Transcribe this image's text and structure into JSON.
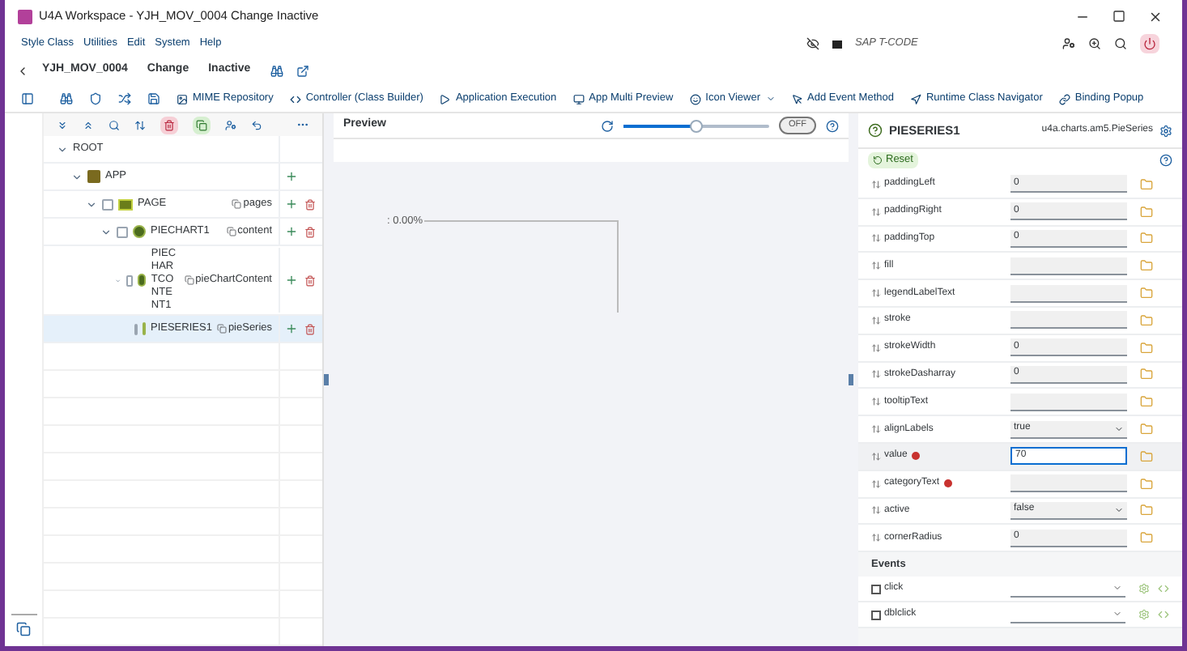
{
  "window": {
    "title": "U4A Workspace - YJH_MOV_0004 Change Inactive"
  },
  "menu": [
    "Style Class",
    "Utilities",
    "Edit",
    "System",
    "Help"
  ],
  "tcode": {
    "placeholder": "SAP T-CODE"
  },
  "breadcrumb": {
    "program": "YJH_MOV_0004",
    "mode": "Change",
    "status": "Inactive"
  },
  "toolbar": [
    {
      "label": "MIME Repository"
    },
    {
      "label": "Controller (Class Builder)"
    },
    {
      "label": "Application Execution"
    },
    {
      "label": "App Multi Preview"
    },
    {
      "label": "Icon Viewer",
      "dropdown": true
    },
    {
      "label": "Add Event Method"
    },
    {
      "label": "Runtime Class Navigator"
    },
    {
      "label": "Binding Popup"
    }
  ],
  "tree": [
    {
      "label": "ROOT",
      "kind": "root",
      "expanded": true,
      "selected": false,
      "children": [
        {
          "label": "APP",
          "kind": "app",
          "expanded": true,
          "selected": false,
          "children": [
            {
              "label": "PAGE",
              "kind": "page",
              "aggregation": "pages",
              "expanded": true,
              "selected": false,
              "children": [
                {
                  "label": "PIECHART1",
                  "kind": "control",
                  "aggregation": "content",
                  "expanded": true,
                  "selected": false,
                  "children": [
                    {
                      "label": "PIECHARTCONTENT1",
                      "kind": "control",
                      "aggregation": "pieChartContent",
                      "expanded": true,
                      "selected": false,
                      "children": [
                        {
                          "label": "PIESERIES1",
                          "kind": "control",
                          "aggregation": "pieSeries",
                          "selected": true
                        }
                      ]
                    }
                  ]
                }
              ]
            }
          ]
        }
      ]
    }
  ],
  "preview": {
    "title": "Preview",
    "zoom": {
      "level": 0.5
    },
    "toggle": {
      "label": "OFF",
      "on": false
    },
    "chart_label": ": 0.00%"
  },
  "properties": {
    "title": "PIESERIES1",
    "class_name": "u4a.charts.am5.PieSeries",
    "reset": "Reset",
    "rows": [
      {
        "name": "paddingLeft",
        "kind": "input",
        "value": "0",
        "required": false,
        "focused": false
      },
      {
        "name": "paddingRight",
        "kind": "input",
        "value": "0",
        "required": false,
        "focused": false
      },
      {
        "name": "paddingTop",
        "kind": "input",
        "value": "0",
        "required": false,
        "focused": false
      },
      {
        "name": "fill",
        "kind": "input",
        "required": false,
        "focused": false
      },
      {
        "name": "legendLabelText",
        "kind": "input",
        "required": false,
        "focused": false
      },
      {
        "name": "stroke",
        "kind": "input",
        "required": false,
        "focused": false
      },
      {
        "name": "strokeWidth",
        "kind": "input",
        "value": "0",
        "required": false,
        "focused": false
      },
      {
        "name": "strokeDasharray",
        "kind": "input",
        "value": "0",
        "required": false,
        "focused": false
      },
      {
        "name": "tooltipText",
        "kind": "input",
        "required": false,
        "focused": false
      },
      {
        "name": "alignLabels",
        "kind": "select",
        "value": "true",
        "required": false,
        "focused": false
      },
      {
        "name": "value",
        "kind": "input",
        "value": "70",
        "required": true,
        "focused": true
      },
      {
        "name": "categoryText",
        "kind": "input",
        "required": true,
        "focused": false
      },
      {
        "name": "active",
        "kind": "select",
        "value": "false",
        "required": false,
        "focused": false
      },
      {
        "name": "cornerRadius",
        "kind": "input",
        "value": "0",
        "required": false,
        "focused": false
      }
    ],
    "events_title": "Events",
    "events": [
      {
        "name": "click",
        "checked": false
      },
      {
        "name": "dblclick",
        "checked": false
      }
    ]
  }
}
